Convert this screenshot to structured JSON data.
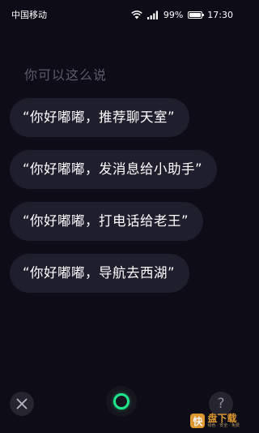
{
  "status_bar": {
    "carrier": "中国移动",
    "battery_text": "99%",
    "battery_level": 0.99,
    "time": "17:30"
  },
  "hint": {
    "title": "你可以这么说"
  },
  "suggestions": [
    {
      "label": "“你好嘟嘟，推荐聊天室”"
    },
    {
      "label": "“你好嘟嘟，发消息给小助手”"
    },
    {
      "label": "“你好嘟嘟，打电话给老王”"
    },
    {
      "label": "“你好嘟嘟，导航去西湖”"
    }
  ],
  "bottom_bar": {
    "close_icon": "close-icon",
    "mic_icon": "voice-ring-icon",
    "help_icon": "question-icon",
    "help_glyph": "?"
  },
  "watermark": {
    "glyph": "快",
    "main": "盘下载",
    "sub": "绿色 · 安全 · 免费"
  },
  "colors": {
    "background": "#0d0c17",
    "bubble": "#1f1e2c",
    "accent": "#1ee88a",
    "hint_text": "#5c5a6b"
  }
}
